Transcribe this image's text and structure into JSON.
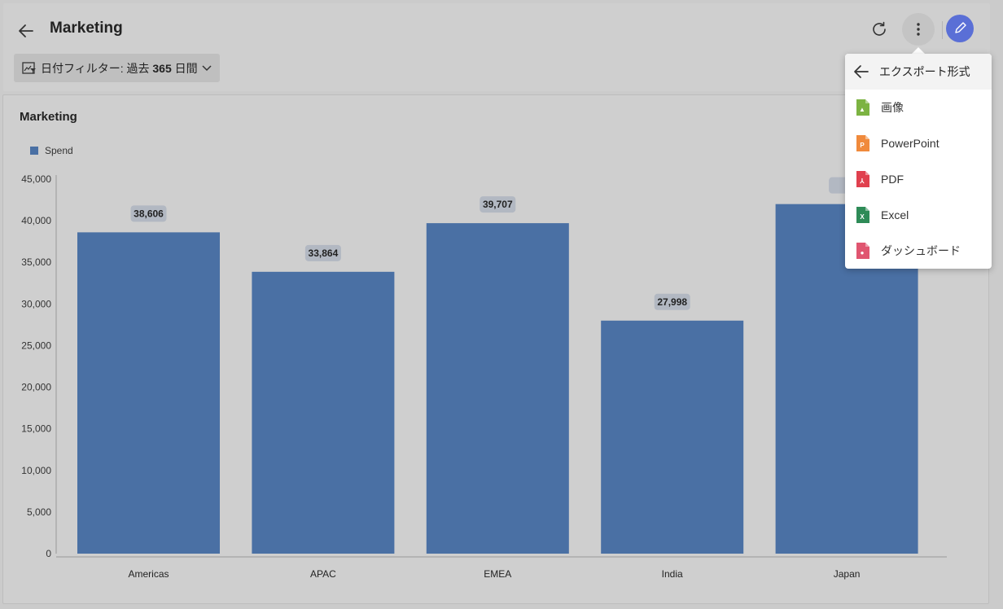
{
  "header": {
    "title": "Marketing",
    "filter": {
      "label_prefix": "日付フィルター: 過去 ",
      "label_bold": "365",
      "label_suffix": " 日間"
    }
  },
  "card": {
    "title": "Marketing",
    "legend": "Spend"
  },
  "menu": {
    "header": "エクスポート形式",
    "items": [
      {
        "label": "画像",
        "icon": "image-file-icon",
        "color": "#7cb342"
      },
      {
        "label": "PowerPoint",
        "icon": "powerpoint-file-icon",
        "color": "#f08a3c"
      },
      {
        "label": "PDF",
        "icon": "pdf-file-icon",
        "color": "#e0404e"
      },
      {
        "label": "Excel",
        "icon": "excel-file-icon",
        "color": "#2e8b57"
      },
      {
        "label": "ダッシュボード",
        "icon": "dashboard-file-icon",
        "color": "#e05570"
      }
    ]
  },
  "colors": {
    "bar": "#4a70a4",
    "accent": "#5a6fd6"
  },
  "chart_data": {
    "type": "bar",
    "title": "Marketing",
    "categories": [
      "Americas",
      "APAC",
      "EMEA",
      "India",
      "Japan"
    ],
    "series": [
      {
        "name": "Spend",
        "values": [
          38606,
          33864,
          39707,
          27998,
          42000
        ]
      }
    ],
    "data_labels": [
      "38,606",
      "33,864",
      "39,707",
      "27,998",
      ""
    ],
    "yticks": [
      "0",
      "5,000",
      "10,000",
      "15,000",
      "20,000",
      "25,000",
      "30,000",
      "35,000",
      "40,000",
      "45,000"
    ],
    "ylim": [
      0,
      45000
    ],
    "grid": false,
    "legend_position": "top-left"
  }
}
